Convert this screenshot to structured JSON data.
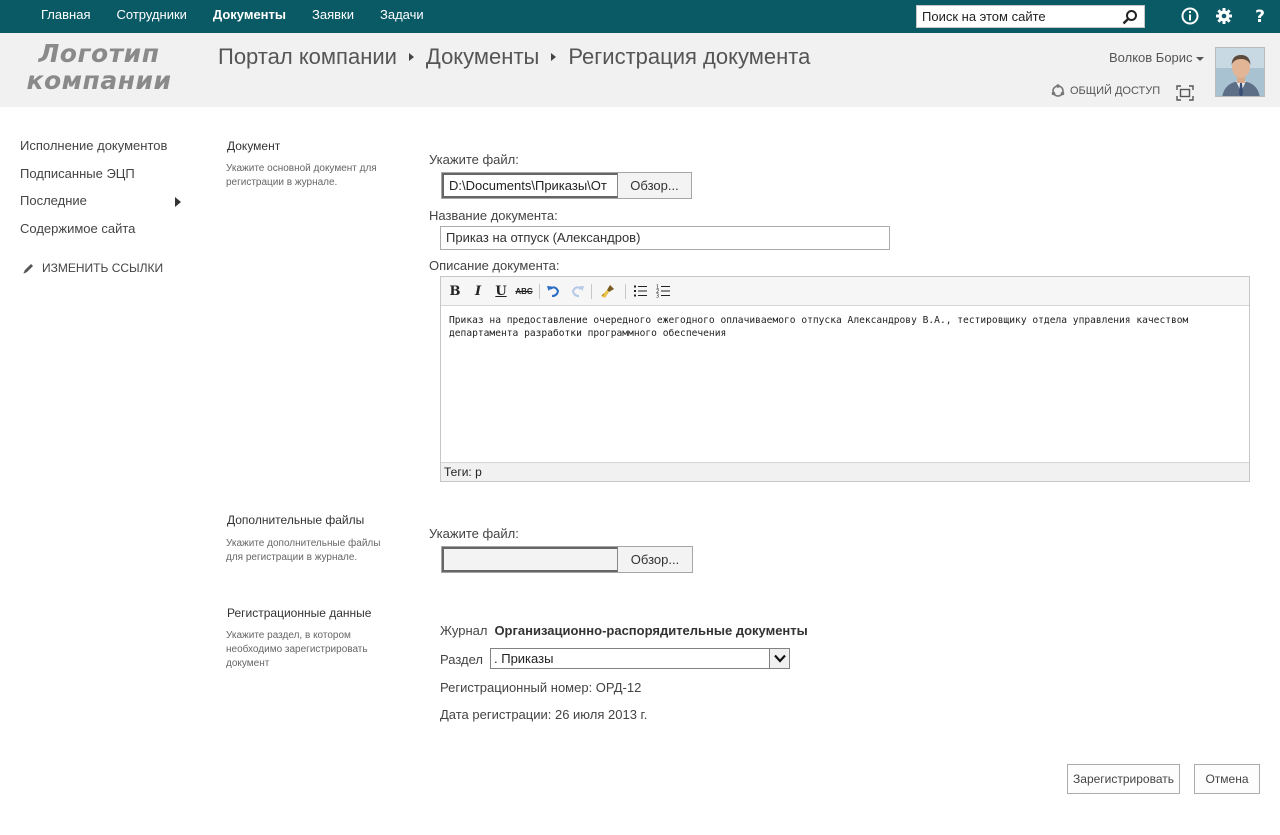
{
  "topnav": {
    "items": [
      {
        "label": "Главная",
        "active": false
      },
      {
        "label": "Сотрудники",
        "active": false
      },
      {
        "label": "Документы",
        "active": true
      },
      {
        "label": "Заявки",
        "active": false
      },
      {
        "label": "Задачи",
        "active": false
      }
    ],
    "search_placeholder": "Поиск на этом сайте",
    "icons": [
      "search-icon",
      "info-icon",
      "gear-icon",
      "help-icon"
    ]
  },
  "header": {
    "logo_line1": "Логотип",
    "logo_line2": "компании",
    "breadcrumb": [
      "Портал компании",
      "Документы",
      "Регистрация документа"
    ],
    "user_name": "Волков Борис",
    "share_label": "ОБЩИЙ ДОСТУП"
  },
  "leftnav": {
    "items": [
      {
        "label": "Исполнение документов"
      },
      {
        "label": "Подписанные ЭЦП"
      },
      {
        "label": "Последние",
        "has_submenu": true
      },
      {
        "label": "Содержимое сайта"
      }
    ],
    "edit_links": "ИЗМЕНИТЬ ССЫЛКИ"
  },
  "document_section": {
    "title": "Документ",
    "description": "Укажите основной документ для регистрации в журнале.",
    "file_label": "Укажите файл:",
    "file_path": "D:\\Documents\\Приказы\\От",
    "browse_label": "Обзор...",
    "name_label": "Название документа:",
    "name_value": "Приказ на отпуск (Александров)",
    "description_label": "Описание документа:",
    "description_value": "Приказ на предоставление очередного ежегодного оплачиваемого отпуска Александрову В.А., тестировщику отдела управления качеством департамента разработки программного обеспечения",
    "tags_label": "Теги: p"
  },
  "extra_files_section": {
    "title": "Дополнительные файлы",
    "description": "Укажите дополнительные файлы для регистрации в журнале.",
    "file_label": "Укажите файл:",
    "file_path": "",
    "browse_label": "Обзор..."
  },
  "registration_section": {
    "title": "Регистрационные данные",
    "description": "Укажите раздел, в котором необходимо зарегистрировать документ",
    "journal_label": "Журнал",
    "journal_value": "Организационно-распорядительные документы",
    "section_label": "Раздел",
    "section_value": ". Приказы",
    "reg_number": "Регистрационный номер: ОРД-12",
    "reg_date": "Дата регистрации: 26 июля 2013 г."
  },
  "actions": {
    "register_label": "Зарегистрировать",
    "cancel_label": "Отмена"
  },
  "colors": {
    "topbar": "#0a5a66",
    "header_bg": "#f1f1f1",
    "undo_blue": "#2b6cc4"
  }
}
